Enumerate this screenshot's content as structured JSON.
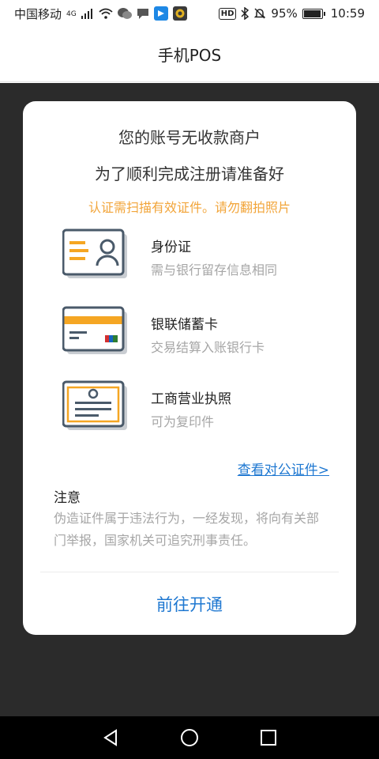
{
  "status_bar": {
    "carrier": "中国移动",
    "network": "4G",
    "hd": "HD",
    "battery_percent": "95%",
    "battery_level": 0.95,
    "time": "10:59"
  },
  "app_header": {
    "title": "手机POS"
  },
  "card": {
    "line1": "您的账号无收款商户",
    "line2": "为了顺利完成注册请准备好",
    "warning": "认证需扫描有效证件。请勿翻拍照片",
    "documents": [
      {
        "name": "身份证",
        "desc": "需与银行留存信息相同",
        "icon": "id-card-icon"
      },
      {
        "name": "银联储蓄卡",
        "desc": "交易结算入账银行卡",
        "icon": "bank-card-icon"
      },
      {
        "name": "工商营业执照",
        "desc": "可为复印件",
        "icon": "business-license-icon"
      }
    ],
    "corporate_link": "查看对公证件>",
    "notice_title": "注意",
    "notice_body": "伪造证件属于违法行为，一经发现，将向有关部门举报，国家机关可追究刑事责任。",
    "cta": "前往开通"
  },
  "colors": {
    "accent_blue": "#1f78d1",
    "warning_orange": "#f2a53a",
    "icon_orange": "#f5a623",
    "icon_slate": "#4a5a6a",
    "backdrop": "#2b2b2b"
  }
}
